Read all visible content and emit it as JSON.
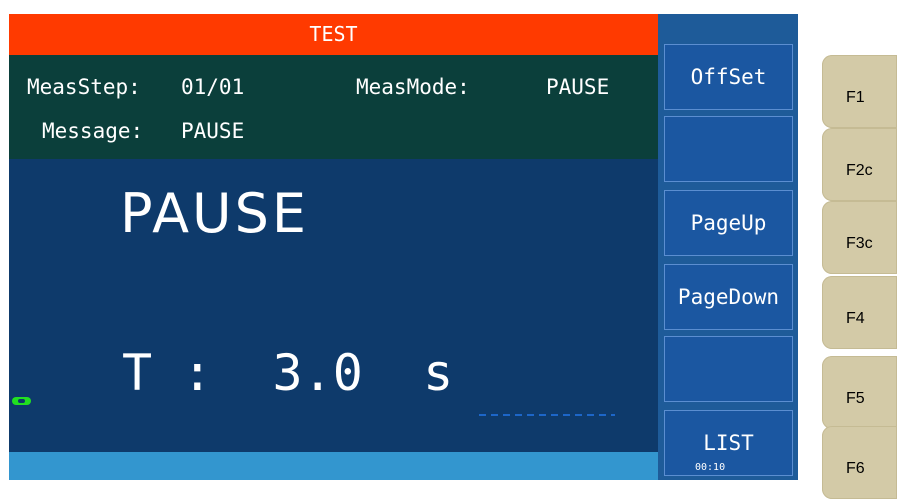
{
  "title": "TEST",
  "info": {
    "meas_step_label": "MeasStep:",
    "meas_step_value": "01/01",
    "meas_mode_label": "MeasMode:",
    "meas_mode_value": "PAUSE",
    "message_label": "Message:",
    "message_value": "PAUSE"
  },
  "status_big": "PAUSE",
  "time_display": {
    "label": "T",
    "separator": ":",
    "value": "3.0",
    "unit": "s"
  },
  "softkeys": [
    "OffSet",
    "",
    "PageUp",
    "PageDown",
    "",
    "LIST"
  ],
  "clock": "00:10",
  "fkeys": [
    "F1",
    "F2c",
    "F3c",
    "F4",
    "F5",
    "F6"
  ],
  "colors": {
    "title_bar": "#ff3a00",
    "info_panel": "#0b3f3b",
    "screen_bg": "#0e3a6b",
    "softkey_bg": "#1b57a1",
    "bottom_bar": "#3396cf",
    "fkey_bg": "#d3caa7",
    "indicator": "#21e021"
  }
}
